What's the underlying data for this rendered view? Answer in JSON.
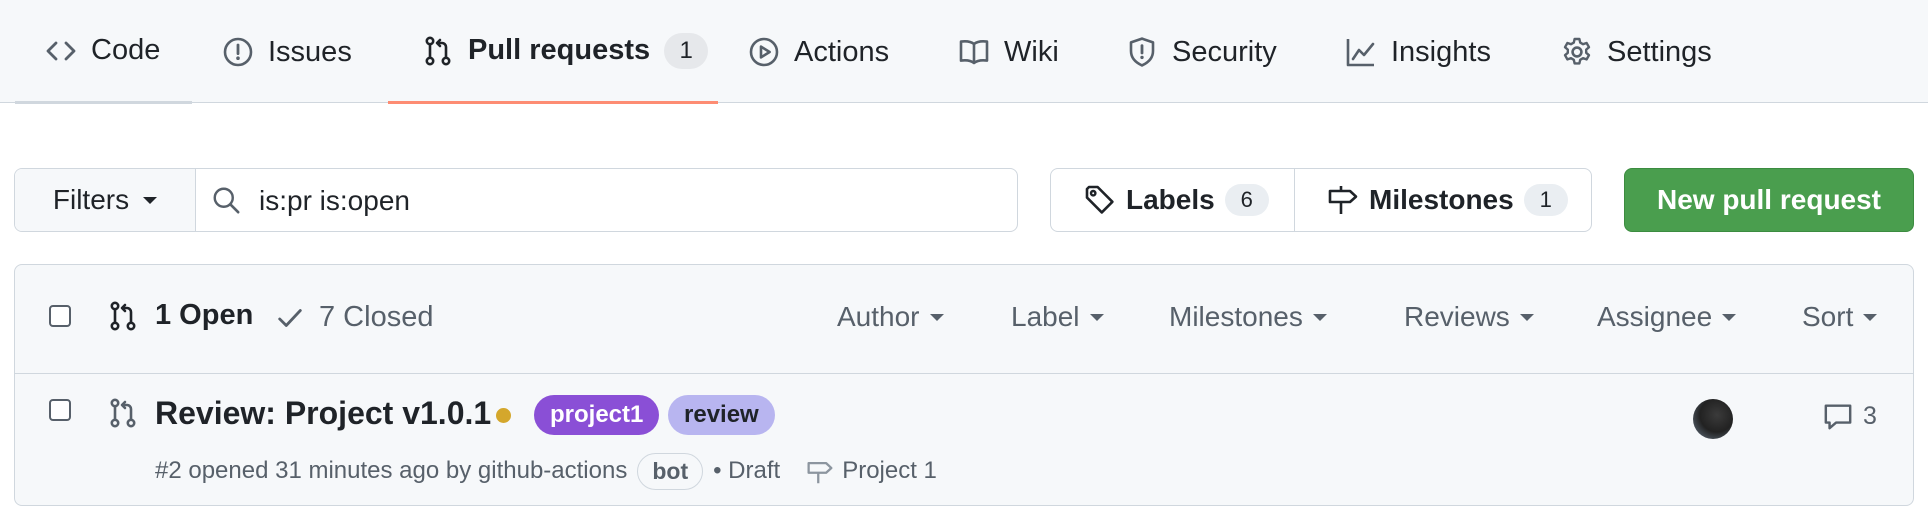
{
  "nav": {
    "tabs": [
      {
        "label": "Code",
        "icon": "code-icon"
      },
      {
        "label": "Issues",
        "icon": "issue-icon"
      },
      {
        "label": "Pull requests",
        "icon": "pull-request-icon",
        "count": "1",
        "selected": true
      },
      {
        "label": "Actions",
        "icon": "play-icon"
      },
      {
        "label": "Wiki",
        "icon": "book-icon"
      },
      {
        "label": "Security",
        "icon": "shield-icon"
      },
      {
        "label": "Insights",
        "icon": "graph-icon"
      },
      {
        "label": "Settings",
        "icon": "gear-icon"
      }
    ]
  },
  "toolbar": {
    "filters_label": "Filters",
    "search_value": "is:pr is:open",
    "labels_label": "Labels",
    "labels_count": "6",
    "milestones_label": "Milestones",
    "milestones_count": "1",
    "new_pr_label": "New pull request",
    "new_pr_color": "#4a9e4e"
  },
  "list": {
    "open_label": "1 Open",
    "closed_label": "7 Closed",
    "sort_menus": [
      "Author",
      "Label",
      "Milestones",
      "Reviews",
      "Assignee",
      "Sort"
    ],
    "rows": [
      {
        "title": "Review: Project v1.0.1",
        "status": "pending",
        "labels": [
          {
            "name": "project1",
            "color": "#8a4fd6"
          },
          {
            "name": "review",
            "color": "#b8b5f0"
          }
        ],
        "meta_text": "#2 opened 31 minutes ago by github-actions",
        "author_badge": "bot",
        "draft_text": "• Draft",
        "milestone": "Project 1",
        "comments": "3"
      }
    ]
  }
}
